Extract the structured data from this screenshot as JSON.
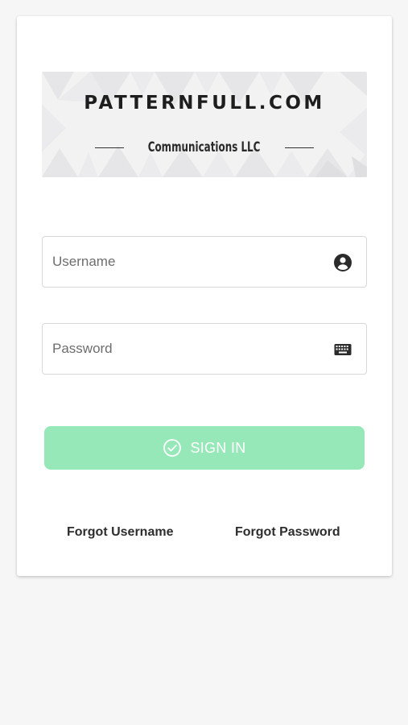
{
  "logo": {
    "title": "PATTERNFULL.COM",
    "subtitle": "Communications LLC"
  },
  "form": {
    "username": {
      "placeholder": "Username",
      "value": "",
      "icon": "account-circle-icon"
    },
    "password": {
      "placeholder": "Password",
      "value": "",
      "icon": "keyboard-icon"
    },
    "signin": {
      "label": "SIGN IN",
      "icon": "check-circle-icon",
      "color": "#96e8b8"
    }
  },
  "links": {
    "forgot_username": "Forgot Username",
    "forgot_password": "Forgot Password"
  }
}
